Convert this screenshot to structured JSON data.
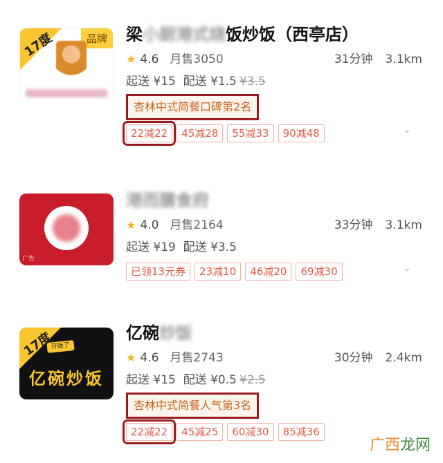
{
  "stores": [
    {
      "name_visible_prefix": "梁",
      "name_blurred": "小厨港式烧",
      "name_visible_suffix": "饭炒饭（西亭店）",
      "rating": "4.6",
      "monthly_sales": "月售3050",
      "time": "31分钟",
      "distance": "3.1km",
      "min_order": "起送 ¥15",
      "delivery_fee": "配送 ¥1.5",
      "delivery_fee_original": "¥3.5",
      "rank_label": "杏林中式简餐口碑第2名",
      "promos": [
        "22减22",
        "45减28",
        "55减33",
        "90减48"
      ],
      "thumb": {
        "brand_tag": "品牌",
        "corner": "17度"
      }
    },
    {
      "name_blurred": "港而膳食府",
      "rating": "4.0",
      "monthly_sales": "月售2164",
      "time": "33分钟",
      "distance": "3.1km",
      "min_order": "起送 ¥19",
      "delivery_fee": "配送 ¥3.5",
      "promos": [
        "已领13元券",
        "23减10",
        "46减20",
        "69减30"
      ],
      "thumb": {
        "ad_tag": "广告"
      }
    },
    {
      "name_visible_prefix": "亿碗",
      "name_blurred": "炒饭",
      "rating": "4.6",
      "monthly_sales": "月售2743",
      "time": "30分钟",
      "distance": "2.4km",
      "min_order": "起送 ¥15",
      "delivery_fee": "配送 ¥0.5",
      "delivery_fee_original": "¥2.5",
      "rank_label": "杏林中式简餐人气第3名",
      "promos": [
        "22减22",
        "45减25",
        "60减30",
        "85减36"
      ],
      "thumb": {
        "corner": "17度",
        "sticker": "开饭了",
        "logo": "亿碗炒饭"
      }
    }
  ],
  "watermark": {
    "part1": "广西",
    "part2": "龙网"
  },
  "colors": {
    "accent_red": "#9b1c20",
    "promo_red": "#e25c45",
    "star": "#f6b41b",
    "rank_text": "#c9631d"
  }
}
